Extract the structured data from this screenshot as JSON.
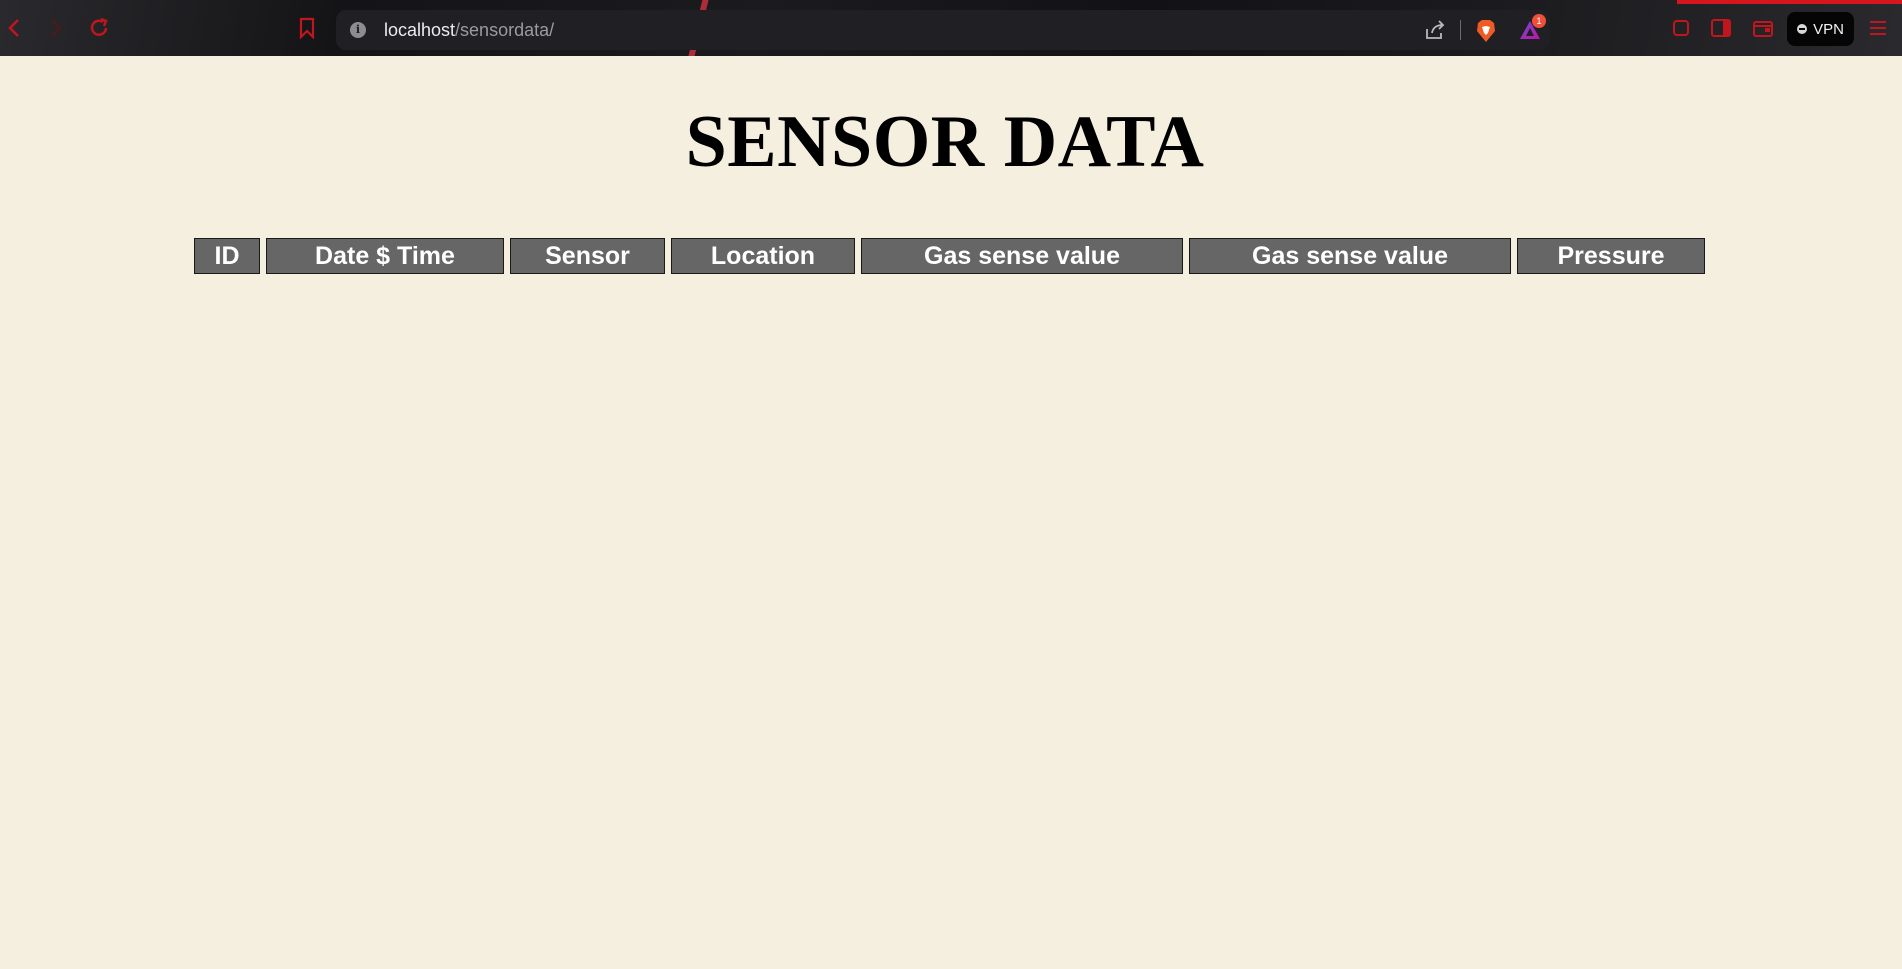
{
  "browser": {
    "url_host": "localhost",
    "url_path": "/sensordata/",
    "info_icon": "i",
    "rewards_badge": "1",
    "vpn_label": "VPN",
    "icons": [
      "back-icon",
      "forward-icon",
      "reload-icon",
      "bookmark-icon",
      "info-icon",
      "share-icon",
      "brave-shields-icon",
      "brave-rewards-icon",
      "extensions-icon",
      "sidebar-icon",
      "wallet-icon",
      "menu-icon"
    ],
    "accent_color": "#d6161d"
  },
  "page": {
    "title": "SENSOR DATA",
    "background": "#f5efe0"
  },
  "table": {
    "columns": [
      "ID",
      "Date $ Time",
      "Sensor",
      "Location",
      "Gas sense value",
      "Gas sense value",
      "Pressure"
    ],
    "rows": [],
    "header_bg": "#666666"
  }
}
